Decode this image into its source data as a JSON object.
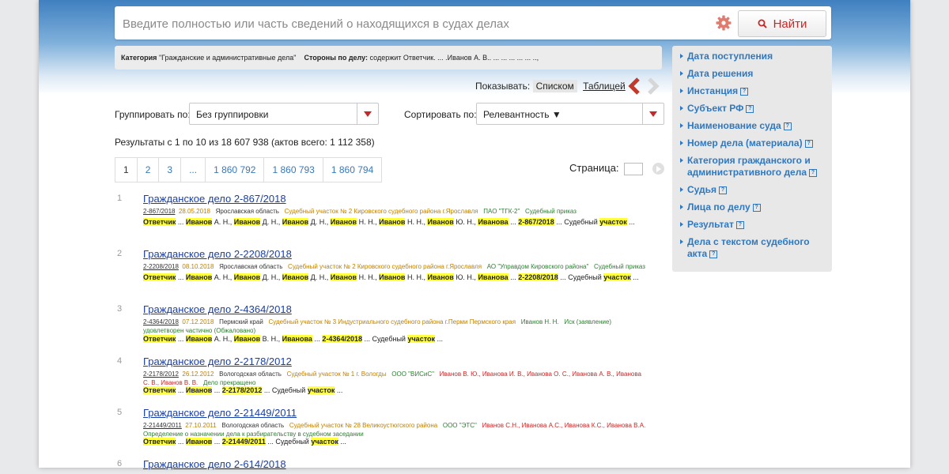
{
  "search": {
    "placeholder": "Введите полностью или часть сведений о находящихся в судах делах",
    "find_label": "Найти"
  },
  "filters": {
    "category_label": "Категория",
    "category_value": "\"Гражданские и административные дела\"",
    "parties_label": "Стороны по делу:",
    "parties_value": "содержит Ответчик. ... .Иванов А. В.. ... ... ... ... ... ..,"
  },
  "view": {
    "show_label": "Показывать:",
    "list_label": "Списком",
    "table_label": "Таблицей"
  },
  "grouping": {
    "group_label": "Группировать по:",
    "group_value": "Без группировки",
    "sort_label": "Сортировать по:",
    "sort_value": "Релевантность ▼"
  },
  "results_text": "Результаты с 1 по 10 из 18 607 938 (актов всего: 1 112 358)",
  "pager": {
    "pages": [
      "1",
      "2",
      "3",
      "...",
      "1 860 792",
      "1 860 793",
      "1 860 794"
    ],
    "page_label": "Страница:"
  },
  "items": [
    {
      "num": "1",
      "title": "Гражданское дело 2-867/2018",
      "case_no": "2-867/2018",
      "date": "28.05.2018",
      "region": "Ярославская область",
      "court": "Судебный участок № 2 Кировского судебного района г.Ярославля",
      "party": "ПАО \"ТГК-2\"",
      "result": "Судебный приказ",
      "snippet": [
        {
          "t": "Ответчик",
          "h": true
        },
        {
          "t": " ... ",
          "h": false
        },
        {
          "t": "Иванов",
          "h": true
        },
        {
          "t": " А. Н., ",
          "h": false
        },
        {
          "t": "Иванов",
          "h": true
        },
        {
          "t": " Д. Н., ",
          "h": false
        },
        {
          "t": "Иванов",
          "h": true
        },
        {
          "t": " Д. Н., ",
          "h": false
        },
        {
          "t": "Иванов",
          "h": true
        },
        {
          "t": " Н. Н., ",
          "h": false
        },
        {
          "t": "Иванов",
          "h": true
        },
        {
          "t": " Н. Н., ",
          "h": false
        },
        {
          "t": "Иванов",
          "h": true
        },
        {
          "t": " Ю. Н., ",
          "h": false
        },
        {
          "t": "Иванова",
          "h": true
        },
        {
          "t": " ... ",
          "h": false
        },
        {
          "t": "2-867/2018",
          "h": true
        },
        {
          "t": " ... Судебный ",
          "h": false
        },
        {
          "t": "участок",
          "h": true
        },
        {
          "t": " ...",
          "h": false
        }
      ]
    },
    {
      "num": "2",
      "title": "Гражданское дело 2-2208/2018",
      "case_no": "2-2208/2018",
      "date": "08.10.2018",
      "region": "Ярославская область",
      "court": "Судебный участок № 2 Кировского судебного района г.Ярославля",
      "party": "АО \"Управдом Кировского района\"",
      "result": "Судебный приказ",
      "snippet": [
        {
          "t": "Ответчик",
          "h": true
        },
        {
          "t": " ... ",
          "h": false
        },
        {
          "t": "Иванов",
          "h": true
        },
        {
          "t": " А. Н., ",
          "h": false
        },
        {
          "t": "Иванов",
          "h": true
        },
        {
          "t": " Д. Н., ",
          "h": false
        },
        {
          "t": "Иванов",
          "h": true
        },
        {
          "t": " Д. Н., ",
          "h": false
        },
        {
          "t": "Иванов",
          "h": true
        },
        {
          "t": " Н. Н., ",
          "h": false
        },
        {
          "t": "Иванов",
          "h": true
        },
        {
          "t": " Н. Н., ",
          "h": false
        },
        {
          "t": "Иванов",
          "h": true
        },
        {
          "t": " Ю. Н., ",
          "h": false
        },
        {
          "t": "Иванова",
          "h": true
        },
        {
          "t": " ... ",
          "h": false
        },
        {
          "t": "2-2208/2018",
          "h": true
        },
        {
          "t": " ... Судебный ",
          "h": false
        },
        {
          "t": "участок",
          "h": true
        },
        {
          "t": " ...",
          "h": false
        }
      ]
    },
    {
      "num": "3",
      "title": "Гражданское дело 2-4364/2018",
      "case_no": "2-4364/2018",
      "date": "07.12.2018",
      "region": "Пермский край",
      "court": "Судебный участок № 3 Индустриального судебного района г.Перми Пермского края",
      "party": "Иванов Н. Н.",
      "result": "Иск (заявление) удовлетворен частично (Обжаловано)",
      "snippet": [
        {
          "t": "Ответчик",
          "h": true
        },
        {
          "t": " ... ",
          "h": false
        },
        {
          "t": "Иванов",
          "h": true
        },
        {
          "t": " А. Н., ",
          "h": false
        },
        {
          "t": "Иванов",
          "h": true
        },
        {
          "t": " В. Н., ",
          "h": false
        },
        {
          "t": "Иванова",
          "h": true
        },
        {
          "t": " ... ",
          "h": false
        },
        {
          "t": "2-4364/2018",
          "h": true
        },
        {
          "t": " ... Судебный ",
          "h": false
        },
        {
          "t": "участок",
          "h": true
        },
        {
          "t": " ...",
          "h": false
        }
      ]
    },
    {
      "num": "4",
      "title": "Гражданское дело 2-2178/2012",
      "case_no": "2-2178/2012",
      "date": "26.12.2012",
      "region": "Вологодская область",
      "court": "Судебный участок № 1 г. Вологды",
      "party": "ООО \"ВИСиС\"",
      "persons": "Иванов В. Ю., Иванова И. В., Иванова О. С., Иванова А. В., Иванова С. В., Иванов В. В.",
      "result": "Дело прекращено",
      "snippet": [
        {
          "t": "Ответчик",
          "h": true
        },
        {
          "t": " ... ",
          "h": false
        },
        {
          "t": "Иванов",
          "h": true
        },
        {
          "t": " ... ",
          "h": false
        },
        {
          "t": "2-2178/2012",
          "h": true
        },
        {
          "t": " ... Судебный ",
          "h": false
        },
        {
          "t": "участок",
          "h": true
        },
        {
          "t": " ...",
          "h": false
        }
      ]
    },
    {
      "num": "5",
      "title": "Гражданское дело 2-21449/2011",
      "case_no": "2-21449/2011",
      "date": "27.10.2011",
      "region": "Вологодская область",
      "court": "Судебный участок № 28 Великоустюгского района",
      "party": "ООО \"ЭТС\"",
      "persons": "Иванов С.Н., Иванова А.С., Иванова К.С., Иванова В.А.",
      "result": "Определение о назначении дела к разбирательству в судебном заседании",
      "snippet": [
        {
          "t": "Ответчик",
          "h": true
        },
        {
          "t": " ... ",
          "h": false
        },
        {
          "t": "Иванов",
          "h": true
        },
        {
          "t": " ... ",
          "h": false
        },
        {
          "t": "2-21449/2011",
          "h": true
        },
        {
          "t": " ... Судебный ",
          "h": false
        },
        {
          "t": "участок",
          "h": true
        },
        {
          "t": " ...",
          "h": false
        }
      ]
    },
    {
      "num": "6",
      "title": "Гражданское дело 2-614/2018"
    }
  ],
  "sidebar": {
    "items": [
      {
        "label": "Дата поступления",
        "help": false
      },
      {
        "label": "Дата решения",
        "help": false
      },
      {
        "label": "Инстанция",
        "help": true
      },
      {
        "label": "Субъект РФ",
        "help": true
      },
      {
        "label": "Наименование суда",
        "help": true
      },
      {
        "label": "Номер дела (материала)",
        "help": true
      },
      {
        "label": "Категория гражданского и административного дела",
        "help": true
      },
      {
        "label": "Судья",
        "help": true
      },
      {
        "label": "Лица по делу",
        "help": true
      },
      {
        "label": "Результат",
        "help": true
      },
      {
        "label": "Дела с текстом судебного акта",
        "help": true
      }
    ]
  },
  "colors": {
    "accent_red": "#c62828",
    "link_blue": "#1a3ea8",
    "sidebar_blue": "#2f78c0",
    "highlight": "#ffff3f"
  }
}
